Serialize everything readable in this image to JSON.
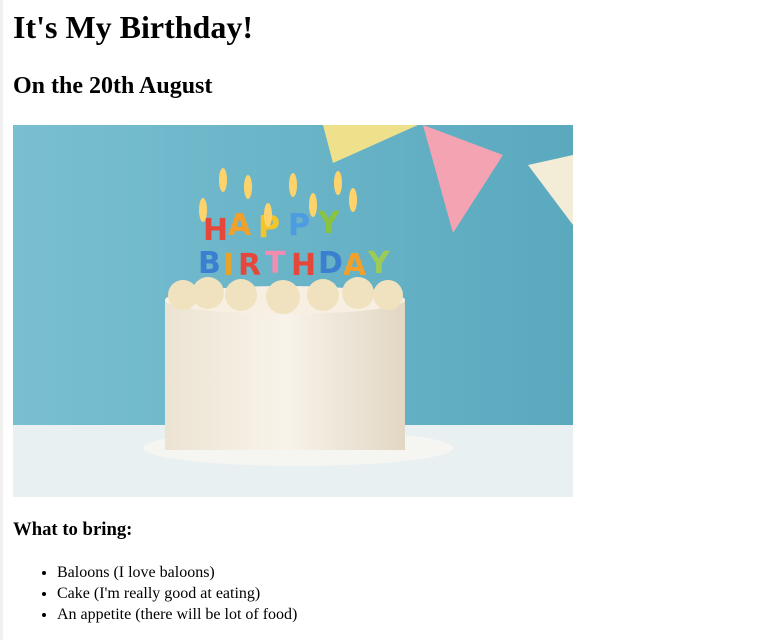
{
  "title": "It's My Birthday!",
  "subtitle": "On the 20th August",
  "image": {
    "alt": "Birthday cake with Happy Birthday candles",
    "candle_text": "HAPPY BIRTHDAY"
  },
  "bring_heading": "What to bring:",
  "bring_items": [
    "Baloons (I love baloons)",
    "Cake (I'm really good at eating)",
    "An appetite (there will be lot of food)"
  ],
  "colors": {
    "background": "#6fb6c9",
    "table": "#e6eef0",
    "cake": "#f3ece0"
  }
}
